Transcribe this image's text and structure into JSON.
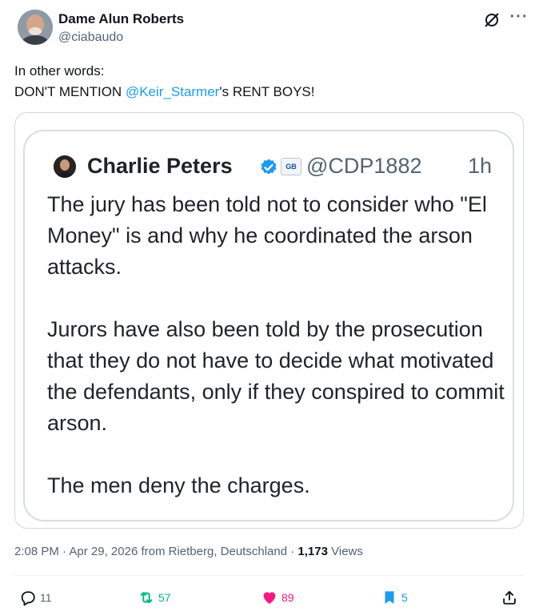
{
  "author": {
    "name": "Dame Alun Roberts",
    "handle": "@ciabaudo"
  },
  "tweet": {
    "line1": "In other words:",
    "line2_pre": "DON'T MENTION ",
    "mention": "@Keir_Starmer",
    "line2_post": "'s RENT BOYS!"
  },
  "quoted_screenshot": {
    "name": "Charlie Peters",
    "badge": "GB",
    "handle": "@CDP1882",
    "time": "1h",
    "paragraph1": "The jury has been told not to consider who \"El Money\" is and why he coordinated the arson attacks.",
    "paragraph2": "Jurors have also been told by the prosecution that they do not have to decide what motivated the defendants, only if they conspired to commit arson.",
    "paragraph3": "The men deny the charges."
  },
  "meta": {
    "time": "2:08 PM",
    "date": "Apr 29, 2026",
    "location": "from Rietberg, Deutschland",
    "views_count": "1,173",
    "views_label": "Views"
  },
  "actions": {
    "replies": "11",
    "retweets": "57",
    "likes": "89",
    "bookmarks": "5"
  },
  "colors": {
    "link": "#1d9bf0",
    "retweet": "#00ba7c",
    "like": "#f91880",
    "secondary_text": "#536471"
  }
}
